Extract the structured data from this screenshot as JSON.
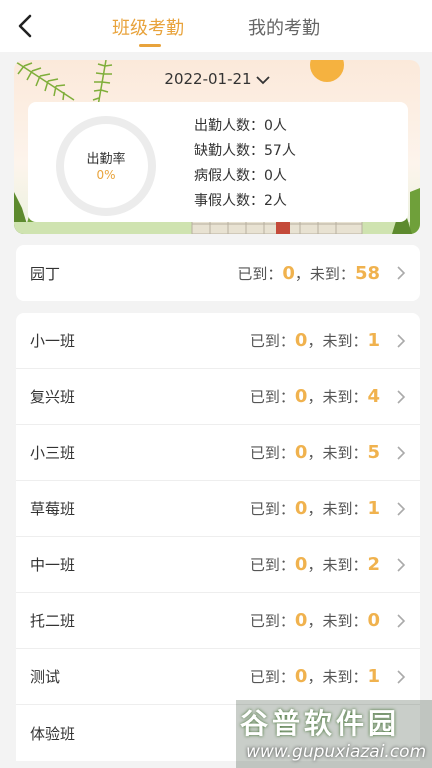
{
  "header": {
    "tabs": [
      {
        "label": "班级考勤",
        "active": true
      },
      {
        "label": "我的考勤",
        "active": false
      }
    ],
    "back_icon": "chevron-left-icon"
  },
  "summary": {
    "date": "2022-01-21",
    "rate_label": "出勤率",
    "rate_value": "0%",
    "stats": [
      {
        "label": "出勤人数：",
        "value": "0人"
      },
      {
        "label": "缺勤人数：",
        "value": "57人"
      },
      {
        "label": "病假人数：",
        "value": "0人"
      },
      {
        "label": "事假人数：",
        "value": "2人"
      }
    ]
  },
  "staff_row": {
    "name": "园丁",
    "arrived_label": "已到：",
    "arrived": "0",
    "sep": "，",
    "absent_label": "未到：",
    "absent": "58"
  },
  "classes": [
    {
      "name": "小一班",
      "arrived_label": "已到：",
      "arrived": "0",
      "sep": "，",
      "absent_label": "未到：",
      "absent": "1"
    },
    {
      "name": "复兴班",
      "arrived_label": "已到：",
      "arrived": "0",
      "sep": "，",
      "absent_label": "未到：",
      "absent": "4"
    },
    {
      "name": "小三班",
      "arrived_label": "已到：",
      "arrived": "0",
      "sep": "，",
      "absent_label": "未到：",
      "absent": "5"
    },
    {
      "name": "草莓班",
      "arrived_label": "已到：",
      "arrived": "0",
      "sep": "，",
      "absent_label": "未到：",
      "absent": "1"
    },
    {
      "name": "中一班",
      "arrived_label": "已到：",
      "arrived": "0",
      "sep": "，",
      "absent_label": "未到：",
      "absent": "2"
    },
    {
      "name": "托二班",
      "arrived_label": "已到：",
      "arrived": "0",
      "sep": "，",
      "absent_label": "未到：",
      "absent": "0"
    },
    {
      "name": "测试",
      "arrived_label": "已到：",
      "arrived": "0",
      "sep": "，",
      "absent_label": "未到：",
      "absent": "1"
    },
    {
      "name": "体验班",
      "arrived_label": "",
      "arrived": "",
      "sep": "",
      "absent_label": "",
      "absent": ""
    }
  ],
  "watermark": {
    "title": "谷普软件园",
    "url": "www.gupuxiazai.com"
  },
  "colors": {
    "accent": "#e8a33c",
    "number": "#f0b24e"
  }
}
